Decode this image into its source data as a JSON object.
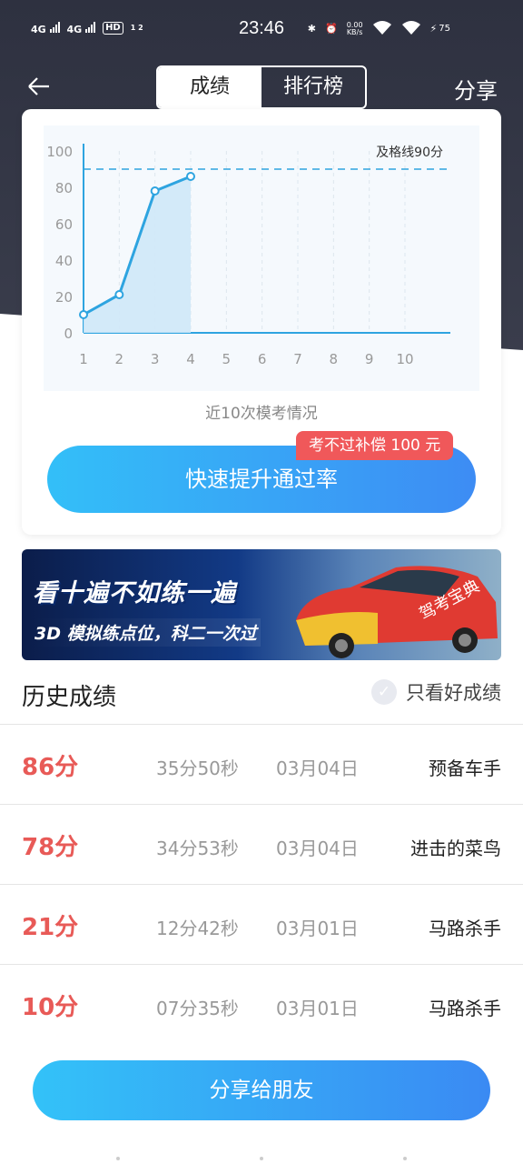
{
  "status_bar": {
    "time": "23:46",
    "sim1": "4G",
    "sim2": "4G",
    "hd": "HD",
    "hd_sub": "1 2",
    "net_speed": "0.00",
    "net_unit": "KB/s",
    "battery": "75"
  },
  "nav": {
    "tab_scores": "成绩",
    "tab_ranking": "排行榜",
    "share": "分享"
  },
  "chart_data": {
    "type": "line",
    "x": [
      1,
      2,
      3,
      4
    ],
    "y": [
      10,
      21,
      78,
      86
    ],
    "x_ticks": [
      "1",
      "2",
      "3",
      "4",
      "5",
      "6",
      "7",
      "8",
      "9",
      "10"
    ],
    "y_ticks": [
      "0",
      "20",
      "40",
      "60",
      "80",
      "100"
    ],
    "xlim": [
      1,
      10
    ],
    "ylim": [
      0,
      100
    ],
    "pass_line": 90,
    "pass_label": "及格线90分",
    "series_color": "#2ea4e0",
    "pass_line_color": "#2ea4e0",
    "grid": true
  },
  "card": {
    "caption": "近10次模考情况",
    "cta": "快速提升通过率",
    "badge": "考不过补偿 100 元"
  },
  "banner": {
    "line1": "看十遍不如练一遍",
    "line2": "3D 模拟练点位，科二一次过",
    "car_text": "驾考宝典"
  },
  "history": {
    "title": "历史成绩",
    "filter": "只看好成绩",
    "rows": [
      {
        "score": "86分",
        "duration": "35分50秒",
        "date": "03月04日",
        "rank": "预备车手"
      },
      {
        "score": "78分",
        "duration": "34分53秒",
        "date": "03月04日",
        "rank": "进击的菜鸟"
      },
      {
        "score": "21分",
        "duration": "12分42秒",
        "date": "03月01日",
        "rank": "马路杀手"
      },
      {
        "score": "10分",
        "duration": "07分35秒",
        "date": "03月01日",
        "rank": "马路杀手"
      }
    ]
  },
  "footer": {
    "share_button": "分享给朋友"
  },
  "colors": {
    "accent_start": "#33bff8",
    "accent_end": "#3d8cf4",
    "score_red": "#e85a57",
    "badge_red": "#f0585a",
    "header_dark": "#2e3140"
  }
}
